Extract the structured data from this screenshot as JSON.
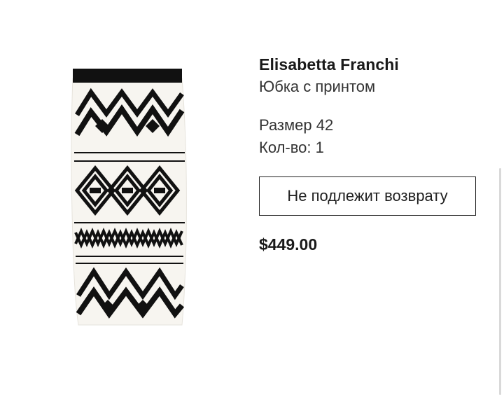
{
  "product": {
    "brand": "Elisabetta Franchi",
    "name": "Юбка с принтом",
    "size": "Размер 42",
    "quantity": "Кол-во: 1",
    "return_policy": "Не подлежит возврату",
    "price": "$449.00",
    "image_icon": "skirt-ikat-print-image"
  },
  "colors": {
    "pattern": "#111111",
    "fabric": "#f7f5f0",
    "text": "#1a1a1a"
  }
}
